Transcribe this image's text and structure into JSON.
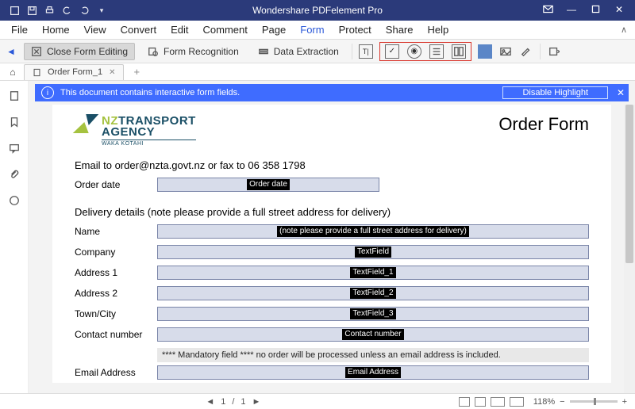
{
  "app": {
    "title": "Wondershare PDFelement Pro"
  },
  "menu": {
    "items": [
      "File",
      "Home",
      "View",
      "Convert",
      "Edit",
      "Comment",
      "Page",
      "Form",
      "Protect",
      "Share",
      "Help"
    ],
    "active": "Form"
  },
  "ribbon": {
    "close_form": "Close Form Editing",
    "form_recognition": "Form Recognition",
    "data_extraction": "Data Extraction"
  },
  "tabs": {
    "name": "Order Form_1"
  },
  "notice": {
    "message": "This document contains interactive form fields.",
    "disable": "Disable Highlight"
  },
  "doc": {
    "logo": {
      "line1a": "NZ",
      "line1b": "TRANSPORT",
      "line2": "AGENCY",
      "line3": "WAKA KOTAHI"
    },
    "title": "Order Form",
    "email_line": "Email to order@nzta.govt.nz or fax to 06 358 1798",
    "delivery_heading": "Delivery details (note please provide a full street address for delivery)",
    "mandatory": "**** Mandatory field **** no order will be processed unless an email address is included.",
    "labels": {
      "order_date": "Order date",
      "name": "Name",
      "company": "Company",
      "address1": "Address 1",
      "address2": "Address 2",
      "town": "Town/City",
      "contact": "Contact number",
      "email": "Email Address"
    },
    "field_tags": {
      "order_date": "Order date",
      "name": "(note please provide a full street address for delivery)",
      "company": "TextField",
      "address1": "TextField_1",
      "address2": "TextField_2",
      "town": "TextField_3",
      "contact": "Contact number",
      "email": "Email Address"
    }
  },
  "status": {
    "page_current": "1",
    "page_sep": "/",
    "page_total": "1",
    "zoom": "118%"
  }
}
